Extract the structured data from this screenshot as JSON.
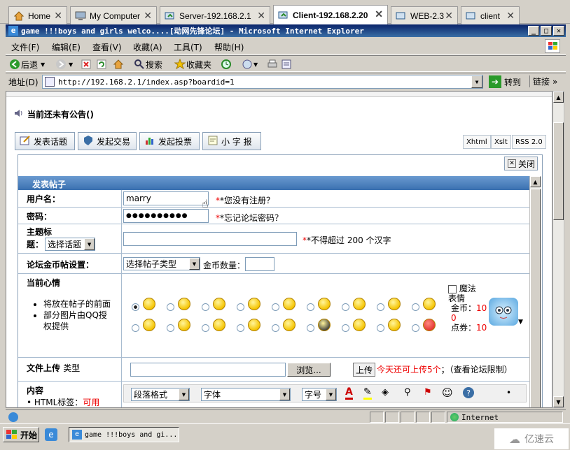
{
  "tabs": [
    {
      "label": "Home"
    },
    {
      "label": "My Computer"
    },
    {
      "label": "Server-192.168.2.1"
    },
    {
      "label": "Client-192.168.2.20"
    },
    {
      "label": "WEB-2.3"
    },
    {
      "label": "client"
    }
  ],
  "window": {
    "title": "game !!!boys and girls welco....[动网先锋论坛] - Microsoft Internet Explorer"
  },
  "menu": [
    "文件(F)",
    "编辑(E)",
    "查看(V)",
    "收藏(A)",
    "工具(T)",
    "帮助(H)"
  ],
  "toolbar": {
    "back": "后退",
    "search": "搜索",
    "favorites": "收藏夹"
  },
  "address": {
    "label": "地址(D)",
    "url": "http://192.168.2.1/index.asp?boardid=1",
    "go": "转到",
    "links": "链接"
  },
  "notice": "当前还未有公告()",
  "actions": [
    "发表话题",
    "发起交易",
    "发起投票",
    "小 字 报"
  ],
  "small_buttons": [
    "Xhtml",
    "Xslt",
    "RSS 2.0"
  ],
  "close": "关闭",
  "form": {
    "header": "发表帖子",
    "username_label": "用户名：",
    "username_value": "marry",
    "register_hint": "*您没有注册？",
    "password_label": "密码：",
    "password_value": "●●●●●●●●●●",
    "forgot_hint": "*忘记论坛密码？",
    "subject_label_1": "主题标",
    "subject_label_2": "题：",
    "topic_select": "选择话题",
    "subject_hint": "*不得超过 200 个汉字",
    "gold_label": "论坛金币帖设置：",
    "gold_select": "选择帖子类型",
    "gold_amount_label": "金币数量：",
    "mood_label": "当前心情",
    "mood_note_1": "将放在帖子的前面",
    "mood_note_2": "部分图片由QQ授权提供",
    "magic_label": "魔法",
    "magic_2": "表情",
    "coin_label": "金币：",
    "coin_value": "100",
    "coupon_label": "点券：",
    "coupon_value": "10",
    "upload_label": "文件上传",
    "upload_type": "类型",
    "browse": "浏览...",
    "upload_btn": "上传",
    "upload_hint": "今天还可上传5个",
    "upload_limit": "（查看论坛限制）",
    "content_label": "内容",
    "html_label": "HTML标签：",
    "html_value": "可用",
    "para_select": "段落格式",
    "font_select": "字体",
    "size_select": "字号"
  },
  "status": {
    "zone": "Internet"
  },
  "taskbar": {
    "start": "开始",
    "task": "game !!!boys and gi...",
    "watermark": "亿速云"
  }
}
